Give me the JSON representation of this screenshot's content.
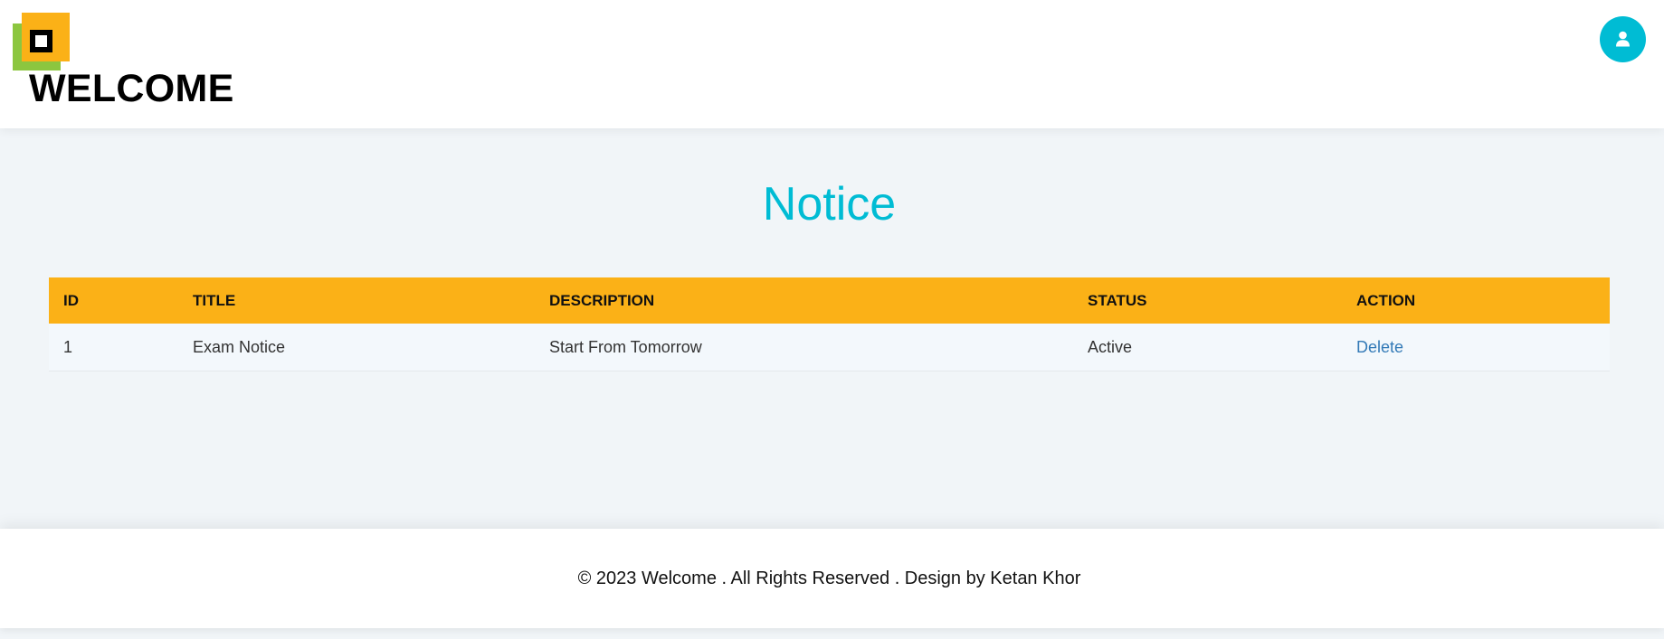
{
  "header": {
    "brand": "WELCOME",
    "logo_colors": {
      "front": "#fbb117",
      "back": "#8cc63f"
    },
    "user_icon": "user-icon",
    "accent": "#00bcd4"
  },
  "main": {
    "title": "Notice",
    "table": {
      "header_color": "#fbb117",
      "columns": {
        "id": "ID",
        "title": "TITLE",
        "description": "DESCRIPTION",
        "status": "STATUS",
        "action": "ACTION"
      },
      "rows": [
        {
          "id": "1",
          "title": "Exam Notice",
          "description": "Start From Tomorrow",
          "status": "Active",
          "action": "Delete"
        }
      ]
    }
  },
  "footer": {
    "text": "© 2023 Welcome . All Rights Reserved . Design by Ketan Khor"
  }
}
